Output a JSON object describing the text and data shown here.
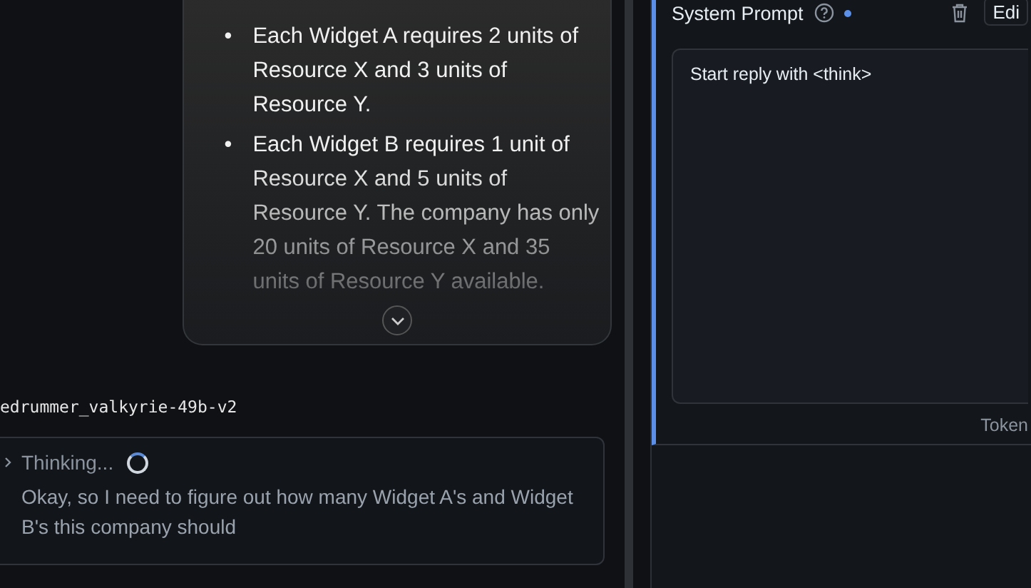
{
  "user_message": {
    "bullets": [
      {
        "marker": "•",
        "text": "Each Widget A requires 2 units of Resource X and 3 units of Resource Y."
      },
      {
        "marker": "•",
        "text": "Each Widget B requires 1 unit of Resource X and 5 units of Resource Y. The company has only 20 units of Resource X and 35 units of Resource Y available."
      }
    ]
  },
  "assistant": {
    "model_name": "edrummer_valkyrie-49b-v2",
    "thinking": {
      "label": "Thinking...",
      "expanded": false,
      "loading": true,
      "text": "Okay, so I need to figure out how many Widget A's and Widget B's this company should"
    }
  },
  "side_panel": {
    "title": "System Prompt",
    "modified": true,
    "edit_button": "Edi",
    "prompt_value": "Start reply with <think>",
    "token_label": "Token"
  }
}
